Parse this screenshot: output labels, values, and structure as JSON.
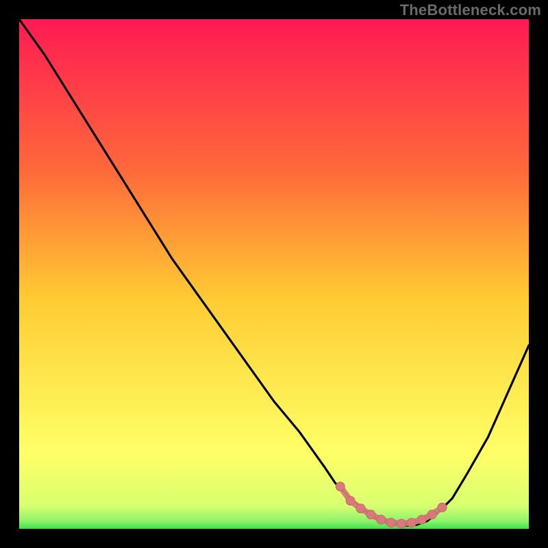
{
  "watermark": "TheBottleneck.com",
  "colors": {
    "background": "#000000",
    "gradient_top": "#ff1a53",
    "gradient_mid1": "#ff6a3a",
    "gradient_mid2": "#ffcc33",
    "gradient_mid3": "#ffff66",
    "gradient_bottom": "#3fe24d",
    "curve_stroke": "#000000",
    "marker_fill": "#d97a7a",
    "marker_stroke": "#c46666"
  },
  "chart_data": {
    "type": "line",
    "title": "",
    "xlabel": "",
    "ylabel": "",
    "xlim": [
      0,
      100
    ],
    "ylim": [
      0,
      100
    ],
    "series": [
      {
        "name": "bottleneck-curve",
        "x": [
          0,
          5,
          10,
          15,
          20,
          25,
          30,
          35,
          40,
          45,
          50,
          55,
          60,
          62,
          65,
          68,
          70,
          72,
          74,
          76,
          78,
          80,
          82,
          85,
          88,
          92,
          96,
          100
        ],
        "y": [
          100,
          93,
          85,
          77,
          69,
          61,
          53,
          46,
          39,
          32,
          25,
          19,
          12,
          9,
          6,
          3.5,
          2,
          1.2,
          0.8,
          0.6,
          0.8,
          1.5,
          3,
          6,
          11,
          18,
          27,
          36
        ]
      }
    ],
    "markers": {
      "name": "optimal-zone-markers",
      "x": [
        63,
        65,
        67,
        69,
        71,
        73,
        75,
        77,
        79,
        81,
        83
      ],
      "y": [
        8.3,
        5.5,
        4.0,
        2.8,
        1.8,
        1.2,
        1.0,
        1.2,
        1.8,
        2.8,
        4.2
      ]
    }
  }
}
